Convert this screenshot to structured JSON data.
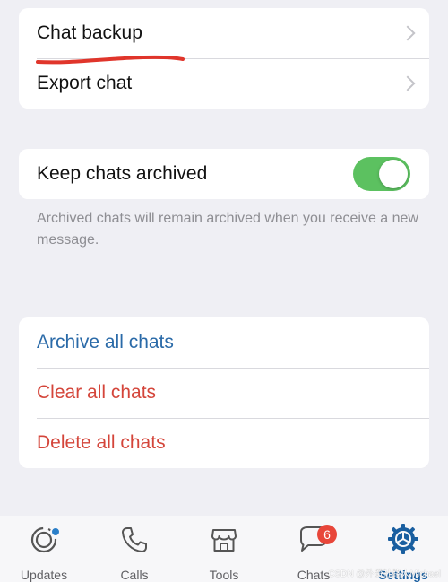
{
  "backup_group": {
    "chat_backup": "Chat backup",
    "export_chat": "Export chat"
  },
  "archive_group": {
    "keep_archived": "Keep chats archived",
    "keep_archived_on": true,
    "footnote": "Archived chats will remain archived when you receive a new message."
  },
  "actions_group": {
    "archive_all": "Archive all chats",
    "clear_all": "Clear all chats",
    "delete_all": "Delete all chats"
  },
  "tabs": [
    {
      "label": "Updates",
      "icon": "updates-icon"
    },
    {
      "label": "Calls",
      "icon": "phone-icon"
    },
    {
      "label": "Tools",
      "icon": "store-icon"
    },
    {
      "label": "Chats",
      "icon": "chat-bubbles-icon",
      "badge": "6"
    },
    {
      "label": "Settings",
      "icon": "gear-icon",
      "active": true
    }
  ],
  "watermark": "CSDN @外贸社路人Michael",
  "colors": {
    "accent_blue": "#2a6aa8",
    "danger_red": "#d4453a",
    "toggle_green": "#5cc160",
    "annotation_red": "#e0352b"
  }
}
